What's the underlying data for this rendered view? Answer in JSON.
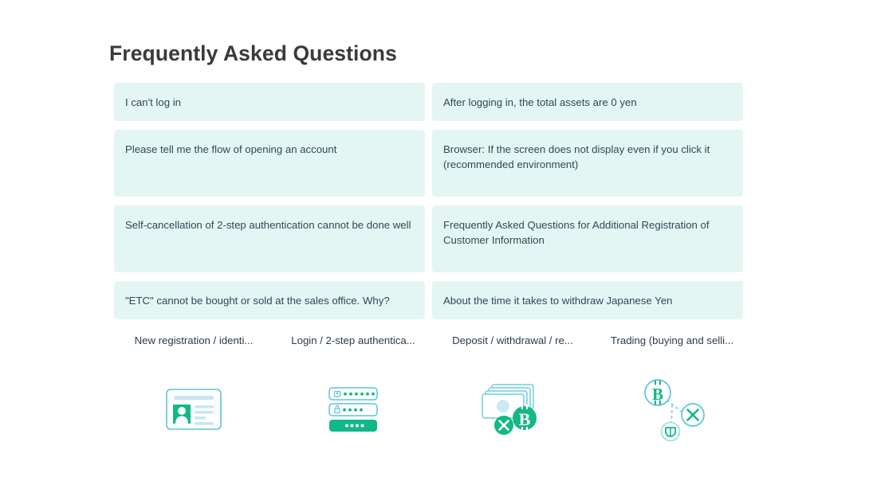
{
  "page": {
    "title": "Frequently Asked Questions",
    "background_color": "#ffffff",
    "title_color": "#3a3a3c",
    "card_background": "#e4f6f3",
    "card_text_color": "#2e4a55",
    "accent_green": "#1bb584",
    "accent_teal": "#4bbfd8",
    "accent_light_blue": "#bfe3f2"
  },
  "faq": {
    "rows": [
      {
        "left": {
          "text": "I can't log in",
          "lines": [
            "I can't log in"
          ]
        },
        "right": {
          "text": "After logging in, the total assets are 0 yen",
          "lines": [
            "After logging in, the total assets are 0 yen"
          ]
        }
      },
      {
        "left": {
          "text": "Please tell me the flow of opening an account",
          "lines": [
            "Please tell me the flow of opening an account"
          ]
        },
        "right": {
          "text": "Browser: If the screen does not display even if you click it (recommended environment)",
          "lines": [
            "Browser: If the screen does not display even if you click it",
            "(recommended environment)"
          ]
        }
      },
      {
        "left": {
          "text": "Self-cancellation of 2-step authentication cannot be done well",
          "lines": [
            "Self-cancellation of 2-step authentication cannot be done well"
          ]
        },
        "right": {
          "text": "Frequently Asked Questions for Additional Registration of Customer Information",
          "lines": [
            "Frequently Asked Questions for Additional Registration of",
            "Customer Information"
          ]
        }
      },
      {
        "left": {
          "text": "\"ETC\" cannot be bought or sold at the sales office. Why?",
          "lines": [
            "\"ETC\" cannot be bought or sold at the sales office. Why?"
          ]
        },
        "right": {
          "text": "About the time it takes to withdraw Japanese Yen",
          "lines": [
            "About the time it takes to withdraw Japanese Yen"
          ]
        }
      }
    ]
  },
  "categories": [
    {
      "label": "New registration / identi...",
      "icon": "id-card-icon"
    },
    {
      "label": "Login / 2-step authentica...",
      "icon": "login-form-icon"
    },
    {
      "label": "Deposit / withdrawal / re...",
      "icon": "banknotes-coins-icon"
    },
    {
      "label": "Trading (buying and selli...",
      "icon": "crypto-network-icon"
    }
  ]
}
